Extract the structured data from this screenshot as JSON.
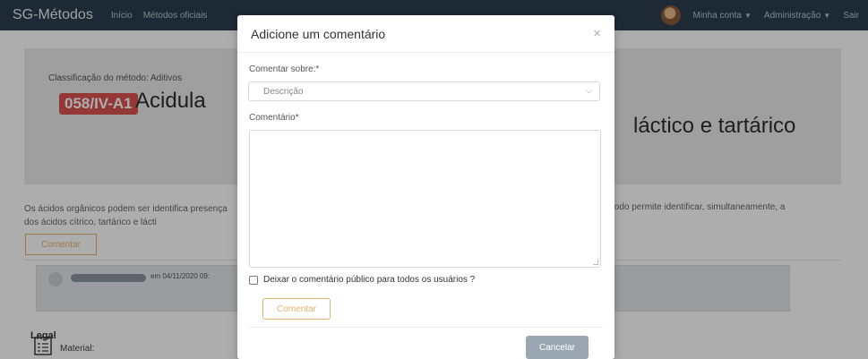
{
  "navbar": {
    "brand": "SG-Métodos",
    "links": [
      "Início",
      "Métodos oficiais"
    ],
    "account": "Minha conta",
    "admin": "Administração",
    "logout": "Sair"
  },
  "page": {
    "classification": "Classificação do método: Aditivos",
    "method_code": "058/IV-A1",
    "title_start": "Acidula",
    "title_end": "láctico e tartárico",
    "description_left": "Os ácidos orgânicos podem ser identifica presença dos ácidos cítrico, tartárico e lácti",
    "description_right": "todo permite identificar, simultaneamente, a",
    "comment_button": "Comentar",
    "comment_date": "em 04/11/2020 09:",
    "comment_text": "Legal",
    "material_label": "Material:"
  },
  "modal": {
    "title": "Adicione um comentário",
    "close": "×",
    "subject_label": "Comentar sobre:*",
    "subject_value": "Descrição",
    "comment_label": "Comentário*",
    "comment_value": "",
    "public_label": "Deixar o comentário público para todos os usuários ?",
    "submit": "Comentar",
    "cancel": "Cancelar"
  }
}
